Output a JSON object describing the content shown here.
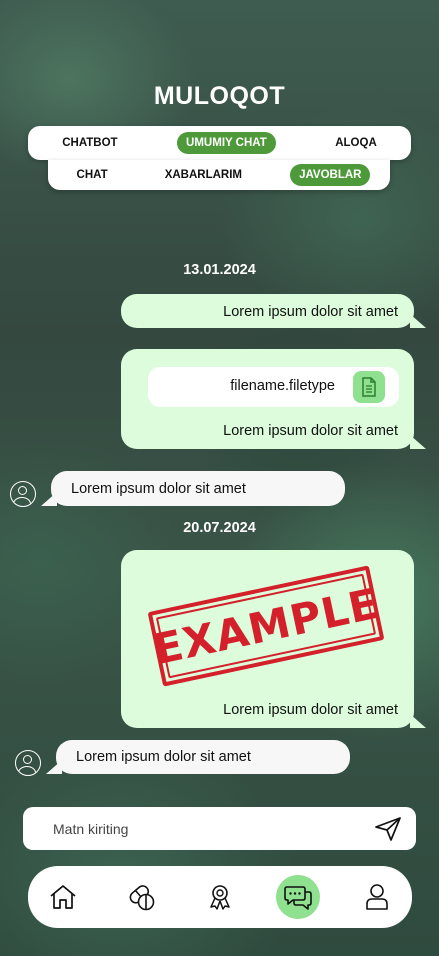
{
  "header": {
    "title": "MULOQOT"
  },
  "tabs_top": [
    {
      "label": "CHATBOT",
      "active": false
    },
    {
      "label": "UMUMIY CHAT",
      "active": true
    },
    {
      "label": "ALOQA",
      "active": false
    }
  ],
  "tabs_bottom": [
    {
      "label": "CHAT",
      "active": false
    },
    {
      "label": "XABARLARIM",
      "active": false
    },
    {
      "label": "JAVOBLAR",
      "active": true
    }
  ],
  "messages": {
    "date_1": "13.01.2024",
    "out_1_text": "Lorem ipsum dolor sit amet",
    "out_2_file": "filename.filetype",
    "out_2_file_icon": "document-icon",
    "out_2_text": "Lorem ipsum dolor sit amet",
    "in_1_text": "Lorem ipsum dolor sit amet",
    "date_2": "20.07.2024",
    "out_3_image_text": "EXAMPLE",
    "out_3_text": "Lorem ipsum dolor sit amet",
    "in_2_text": "Lorem ipsum dolor sit amet"
  },
  "composer": {
    "placeholder": "Matn kiriting",
    "send_icon": "send-icon"
  },
  "bottom_nav": [
    {
      "icon": "home-icon",
      "active": false
    },
    {
      "icon": "pills-icon",
      "active": false
    },
    {
      "icon": "award-icon",
      "active": false
    },
    {
      "icon": "chat-icon",
      "active": true
    },
    {
      "icon": "profile-icon",
      "active": false
    }
  ],
  "colors": {
    "accent": "#4e9a3a",
    "outgoing_bubble": "#dcfcdc",
    "incoming_bubble": "#f7f7f7",
    "active_nav": "#8fe08f",
    "stamp": "#d4202a"
  }
}
